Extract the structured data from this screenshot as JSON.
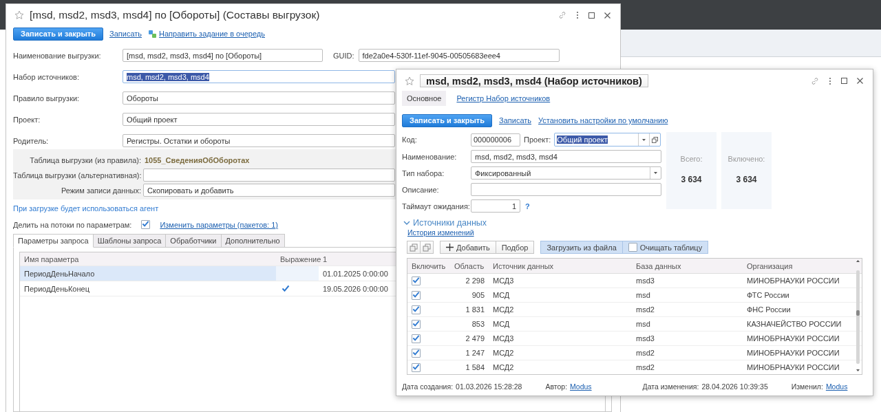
{
  "export_form": {
    "title": "[msd, msd2, msd3, msd4] по [Обороты] (Составы выгрузок)",
    "toolbar": {
      "primary_button": "Записать и закрыть",
      "links": [
        "Записать",
        "Направить задание в очередь"
      ]
    },
    "name_field": {
      "label": "Наименование выгрузки:",
      "value": "[msd, msd2, msd3, msd4] по [Обороты]"
    },
    "guid_field": {
      "label": "GUID:",
      "value": "fde2a0e4-530f-11ef-9045-00505683eee4"
    },
    "fields": [
      {
        "label": "Набор источников:",
        "value": "msd, msd2, msd3, msd4",
        "focused": true,
        "text_highlighted": true
      },
      {
        "label": "Правило выгрузки:",
        "value": "Обороты",
        "focused": false,
        "text_highlighted": false
      },
      {
        "label": "Проект:",
        "value": "Общий проект",
        "focused": false,
        "text_highlighted": false
      },
      {
        "label": "Родитель:",
        "value": "Регистры. Остатки и обороты",
        "focused": false,
        "text_highlighted": false
      }
    ],
    "table_group": [
      {
        "label": "Таблица выгрузки (из правила):",
        "value": "1055_СведенияОбОборотах",
        "kind": "readonly"
      },
      {
        "label": "Таблица выгрузки (альтернативная):",
        "kind": "input"
      },
      {
        "label": "Режим записи данных:",
        "value": "Скопировать и добавить",
        "kind": "input"
      }
    ],
    "agent_note": "При загрузке будет использоваться агент",
    "split_threads": {
      "label": "Делить на потоки по параметрам:",
      "checked": true,
      "link": "Изменить параметры (пакетов: 1)"
    },
    "tabs": [
      {
        "label": "Параметры запроса",
        "selected": true
      },
      {
        "label": "Шаблоны запроса",
        "selected": false
      },
      {
        "label": "Обработчики",
        "selected": false
      },
      {
        "label": "Дополнительно",
        "selected": false
      }
    ],
    "params_table": {
      "columns": [
        "Имя параметра",
        "Выражение",
        "1"
      ],
      "rows": [
        {
          "name": "ПериодДеньНачало",
          "expression": false,
          "value": "01.01.2025 0:00:00",
          "selected": true
        },
        {
          "name": "ПериодДеньКонец",
          "expression": true,
          "value": "19.05.2026 0:00:00",
          "selected": false
        }
      ]
    }
  },
  "source_set_form": {
    "title": "msd, msd2, msd3, msd4 (Набор источников)",
    "tabs": [
      {
        "label": "Основное",
        "selected": true
      },
      {
        "label": "Регистр Набор источников",
        "selected": false
      }
    ],
    "toolbar": {
      "primary_button": "Записать и закрыть",
      "links": [
        "Записать",
        "Установить настройки по умолчанию"
      ]
    },
    "code": {
      "label": "Код:",
      "value": "000000006"
    },
    "project": {
      "label": "Проект:",
      "value": "Общий проект",
      "text_highlighted": true
    },
    "fields": [
      {
        "label": "Наименование:",
        "value": "msd, msd2, msd3, msd4",
        "kind": "text"
      },
      {
        "label": "Тип набора:",
        "value": "Фиксированный",
        "kind": "dropdown"
      },
      {
        "label": "Описание:",
        "kind": "text"
      }
    ],
    "timeout": {
      "label": "Таймаут ожидания:",
      "value": "1",
      "help": "?"
    },
    "stats": [
      {
        "label": "Всего:",
        "value": "3 634"
      },
      {
        "label": "Включено:",
        "value": "3 634"
      }
    ],
    "sources": {
      "title": "Источники данных",
      "expanded": true,
      "history_link": "История изменений",
      "buttons": [
        "Добавить",
        "Подбор"
      ],
      "load_button": {
        "label": "Загрузить из файла",
        "pressed": true
      },
      "clear_table": {
        "label": "Очищать таблицу",
        "checked": false
      },
      "table": {
        "columns": [
          "Включить",
          "Область",
          "Источник данных",
          "База данных",
          "Организация"
        ],
        "rows": [
          {
            "enabled": true,
            "area": "2 298",
            "source": "МСД3",
            "database": "msd3",
            "organization": "МИНОБРНАУКИ РОССИИ"
          },
          {
            "enabled": true,
            "area": "905",
            "source": "МСД",
            "database": "msd",
            "organization": "ФТС России"
          },
          {
            "enabled": true,
            "area": "1 831",
            "source": "МСД2",
            "database": "msd2",
            "organization": "ФНС России"
          },
          {
            "enabled": true,
            "area": "853",
            "source": "МСД",
            "database": "msd",
            "organization": "КАЗНАЧЕЙСТВО РОССИИ"
          },
          {
            "enabled": true,
            "area": "2 479",
            "source": "МСД3",
            "database": "msd3",
            "organization": "МИНОБРНАУКИ РОССИИ"
          },
          {
            "enabled": true,
            "area": "1 247",
            "source": "МСД2",
            "database": "msd2",
            "organization": "МИНОБРНАУКИ РОССИИ"
          },
          {
            "enabled": true,
            "area": "1 584",
            "source": "МСД2",
            "database": "msd2",
            "organization": "МИНОБРНАУКИ РОССИИ"
          }
        ]
      }
    },
    "footer": {
      "created_label": "Дата создания:",
      "created": "01.03.2026 15:28:28",
      "author_label": "Автор:",
      "author": "Modus",
      "modified_label": "Дата изменения:",
      "modified": "28.04.2026 10:39:35",
      "modifier_label": "Изменил:",
      "modifier": "Modus"
    }
  }
}
